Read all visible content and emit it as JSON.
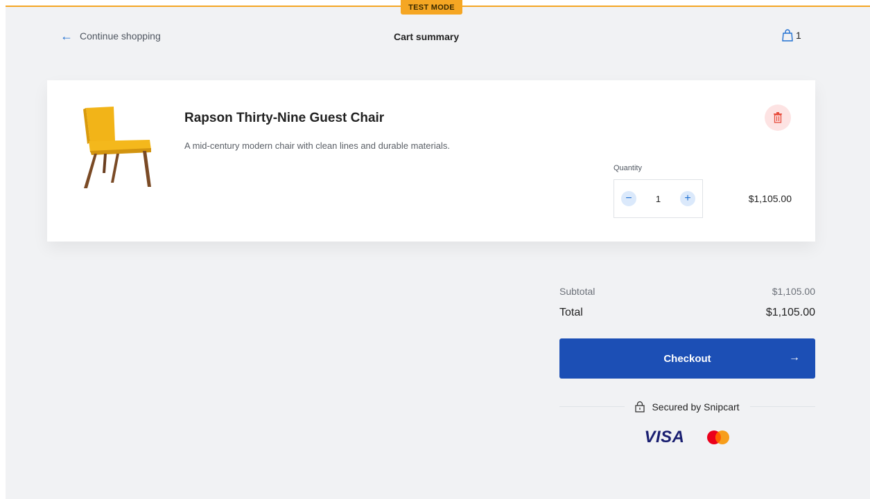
{
  "badge": {
    "test_mode": "TEST MODE"
  },
  "header": {
    "back_label": "Continue shopping",
    "title": "Cart summary",
    "cart_count": "1"
  },
  "item": {
    "name": "Rapson Thirty-Nine Guest Chair",
    "description": "A mid-century modern chair with clean lines and durable materials.",
    "quantity_label": "Quantity",
    "quantity": "1",
    "price": "$1,105.00",
    "image_icon": "yellow-chair-image"
  },
  "summary": {
    "subtotal_label": "Subtotal",
    "subtotal_value": "$1,105.00",
    "total_label": "Total",
    "total_value": "$1,105.00",
    "checkout_label": "Checkout",
    "secured_label": "Secured by Snipcart"
  },
  "payments": {
    "visa": "VISA",
    "mastercard_icon": "mastercard-icon"
  },
  "colors": {
    "accent": "#1c4fb5",
    "link": "#1f6fd1",
    "test_badge": "#f5a623",
    "delete_bg": "#fde3e3",
    "delete_icon": "#e74c3c"
  }
}
